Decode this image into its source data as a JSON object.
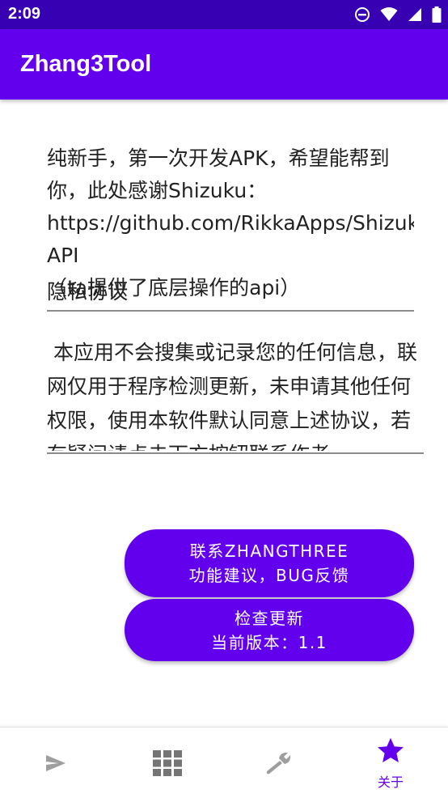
{
  "status_bar": {
    "time": "2:09",
    "icons": [
      "do-not-disturb-icon",
      "wifi-icon",
      "signal-icon",
      "battery-icon"
    ]
  },
  "app_bar": {
    "title": "Zhang3Tool"
  },
  "intro": {
    "text": "纯新手，第一次开发APK，希望能帮到你，此处感谢Shizuku：",
    "link": "https://github.com/RikkaApps/Shizuku-API",
    "text_after": "（ta提供了底层操作的api）"
  },
  "privacy": {
    "title": "隐私协议",
    "text": " 本应用不会搜集或记录您的任何信息，联网仅用于程序检测更新，未申请其他任何权限，使用本软件默认同意上述协议，若有疑问请点击下方按钮联系作者。"
  },
  "buttons": {
    "contact_line1": "联系ZHANGTHREE",
    "contact_line2": "功能建议，BUG反馈",
    "update_line1": "检查更新",
    "update_line2": "当前版本：1.1"
  },
  "bottom_nav": {
    "items": [
      {
        "icon": "send-icon",
        "label": ""
      },
      {
        "icon": "apps-grid-icon",
        "label": ""
      },
      {
        "icon": "wrench-icon",
        "label": ""
      },
      {
        "icon": "star-icon",
        "label": "关于"
      }
    ],
    "active_index": 3
  },
  "colors": {
    "status_bar": "#3700b3",
    "primary": "#6200ee",
    "inactive_icon": "#9e9e9e"
  }
}
